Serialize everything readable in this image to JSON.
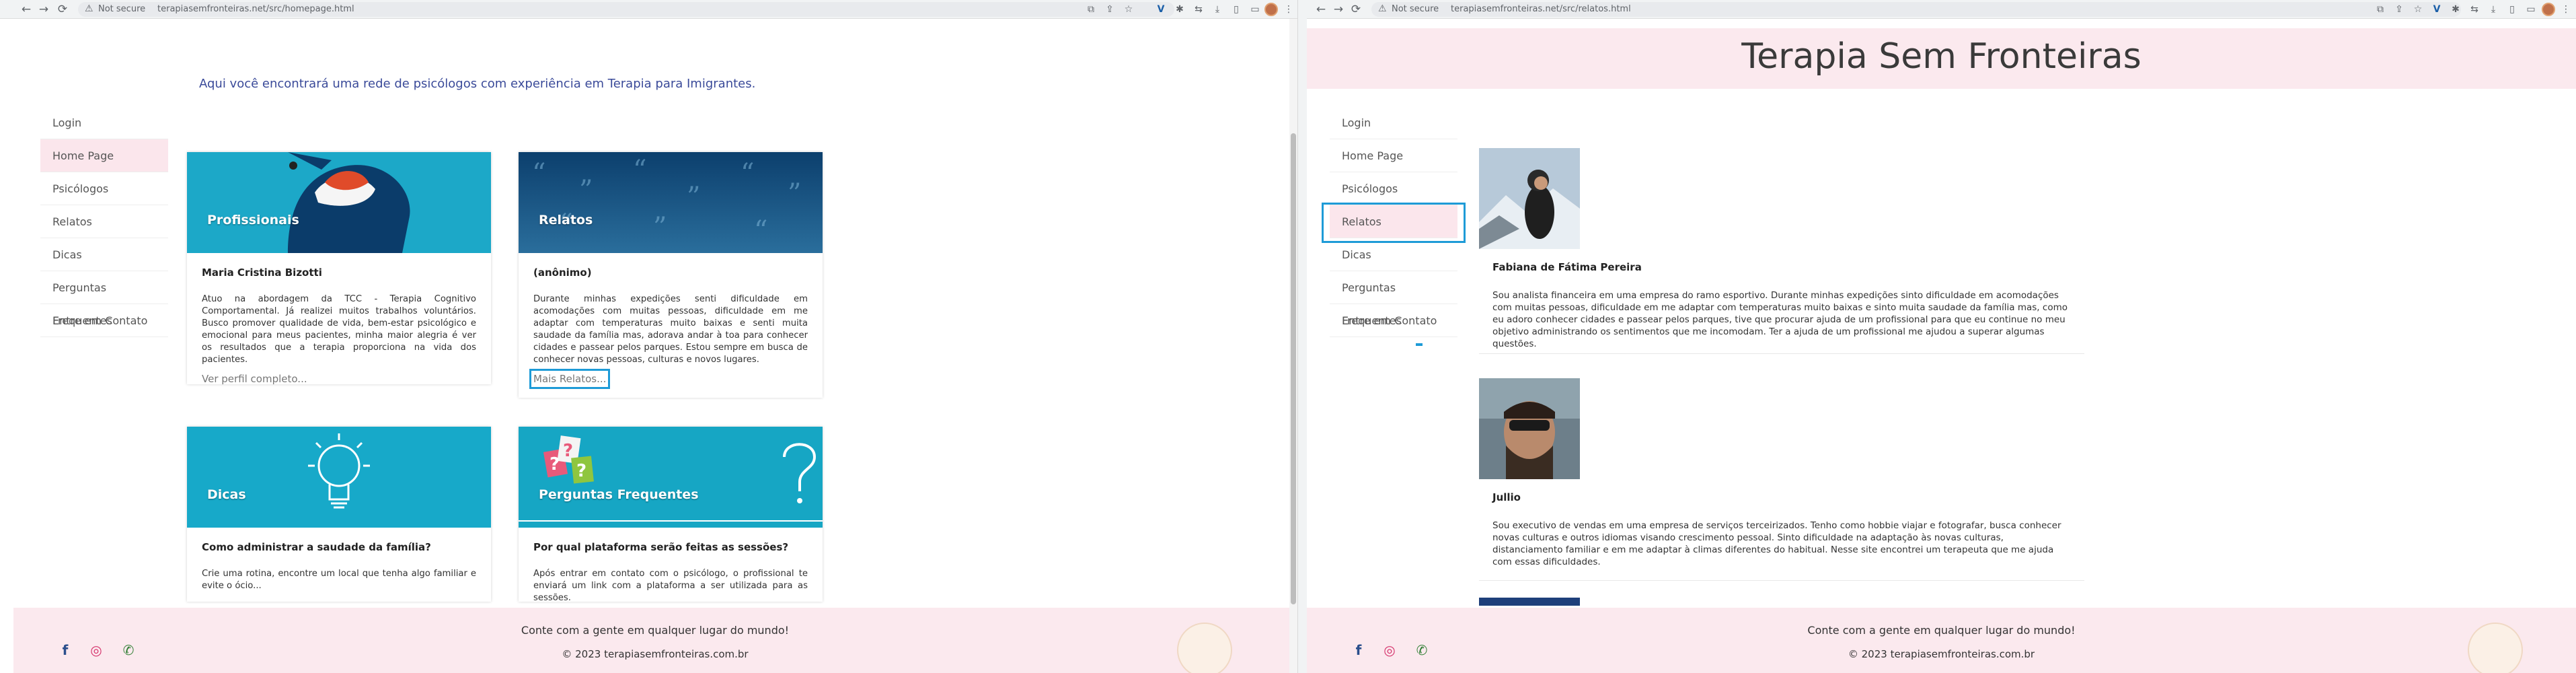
{
  "browser": {
    "not_secure_label": "Not secure",
    "left_url": "terapiasemfronteiras.net/src/homepage.html",
    "right_url": "terapiasemfronteiras.net/src/relatos.html"
  },
  "sidebar": {
    "items": [
      {
        "label": "Login"
      },
      {
        "label": "Home Page"
      },
      {
        "label": "Psicólogos"
      },
      {
        "label": "Relatos"
      },
      {
        "label": "Dicas"
      },
      {
        "label": "Perguntas Frequentes"
      },
      {
        "label": "Entre em Contato"
      }
    ]
  },
  "homepage": {
    "intro": "Aqui você encontrará uma rede de psicólogos com experiência em Terapia para Imigrantes.",
    "cards": [
      {
        "image_title": "Profissionais",
        "heading": "Maria Cristina Bizotti",
        "text": "Atuo na abordagem da TCC - Terapia Cognitivo Comportamental. Já realizei muitos trabalhos voluntários. Busco promover qualidade de vida, bem-estar psicológico e emocional para meus pacientes, minha maior alegria é ver os resultados que a terapia proporciona na vida dos pacientes.",
        "link": "Ver perfil completo..."
      },
      {
        "image_title": "Relatos",
        "heading": "(anônimo)",
        "text": "Durante minhas expedições senti dificuldade em acomodações com muitas pessoas, dificuldade em me adaptar com temperaturas muito baixas e senti muita saudade da família mas, adorava andar à toa para conhecer cidades e passear pelos parques. Estou sempre em busca de conhecer novas pessoas, culturas e novos lugares.",
        "link": "Mais Relatos..."
      },
      {
        "image_title": "Dicas",
        "heading": "Como administrar a saudade da família?",
        "text": "Crie uma rotina, encontre um local que tenha algo familiar e evite o ócio..."
      },
      {
        "image_title": "Perguntas Frequentes",
        "heading": "Por qual plataforma serão feitas as sessões?",
        "text": "Após entrar em contato com o psicólogo, o profissional te enviará um link com a plataforma a ser utilizada para as sessões."
      }
    ]
  },
  "relatos": {
    "site_title": "Terapia Sem Fronteiras",
    "posts": [
      {
        "name": "Fabiana de Fátima Pereira",
        "text": "Sou analista financeira em uma empresa do ramo esportivo. Durante minhas expedições sinto dificuldade em acomodações com muitas pessoas, dificuldade em me adaptar com temperaturas muito baixas e sinto muita saudade da família mas, como eu adoro conhecer cidades e passear pelos parques, tive que procurar ajuda de um profissional para que eu continue no meu objetivo administrando os sentimentos que me incomodam. Ter a ajuda de um profissional me ajudou a superar algumas questões."
      },
      {
        "name": "Jullio",
        "text": "Sou executivo de vendas em uma empresa de serviços terceirizados. Tenho como hobbie viajar e fotografar, busca conhecer novas culturas e outros idiomas visando crescimento pessoal. Sinto dificuldade na adaptação às novas culturas, distanciamento familiar e em me adaptar à climas diferentes do habitual. Nesse site encontrei um terapeuta que me ajuda com essas dificuldades."
      }
    ]
  },
  "footer": {
    "tagline": "Conte com a gente em qualquer lugar do mundo!",
    "copyright": "© 2023 terapiasemfronteiras.com.br"
  },
  "icons": {
    "facebook": "facebook-icon",
    "instagram": "instagram-icon",
    "whatsapp": "whatsapp-icon"
  },
  "colors": {
    "accent_pink": "#fbe9ee",
    "focus_blue": "#1e9bd7",
    "card_teal": "#1aa3c4",
    "intro_blue": "#3a4a99"
  }
}
